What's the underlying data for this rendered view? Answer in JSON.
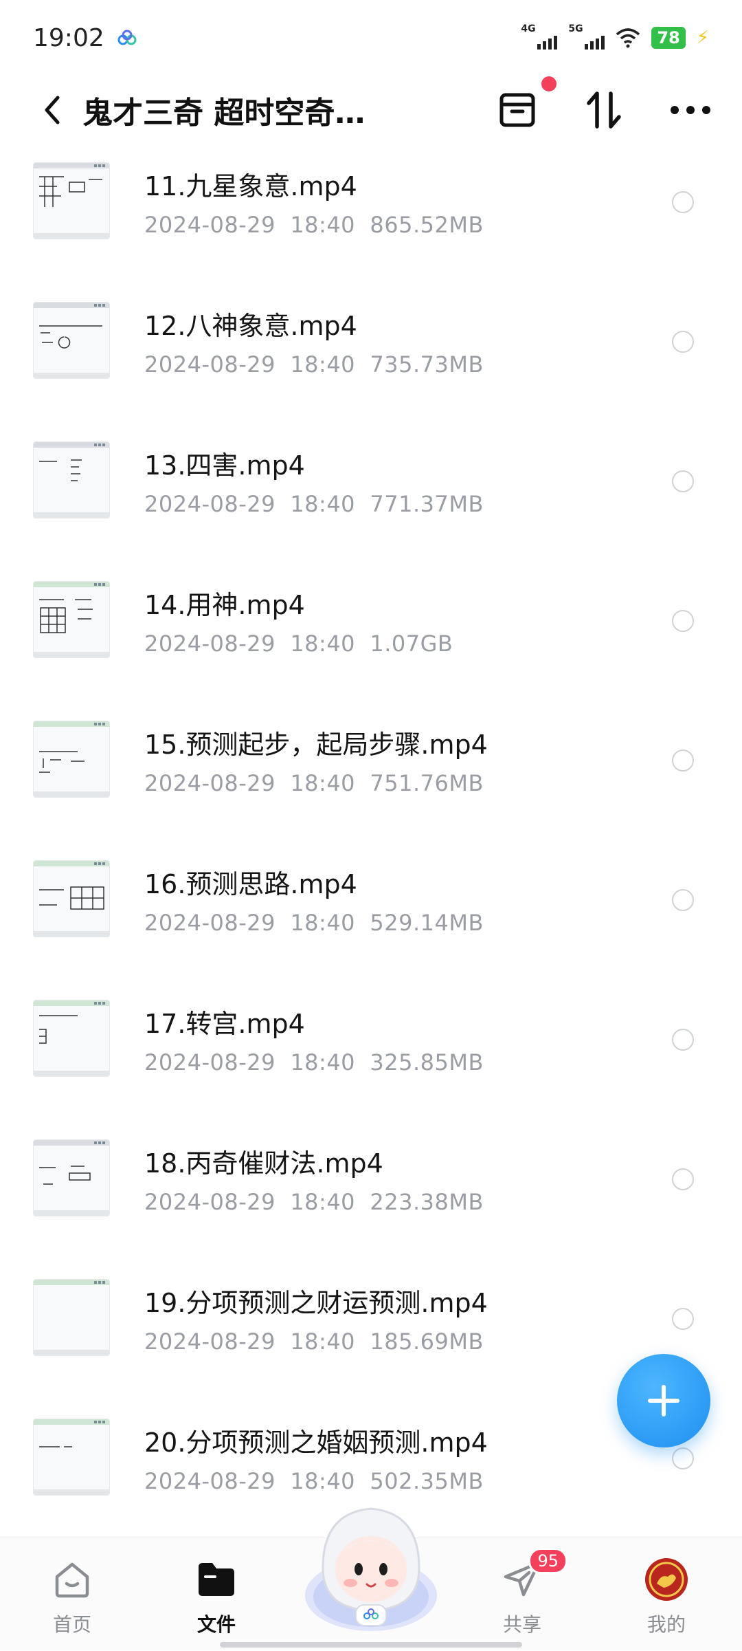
{
  "status_bar": {
    "time": "19:02",
    "network_1": "4G",
    "network_2": "5G",
    "battery": "78"
  },
  "header": {
    "title": "鬼才三奇 超时空奇…"
  },
  "files": [
    {
      "name": "11.九星象意.mp4",
      "date": "2024-08-29",
      "time": "18:40",
      "size": "865.52MB"
    },
    {
      "name": "12.八神象意.mp4",
      "date": "2024-08-29",
      "time": "18:40",
      "size": "735.73MB"
    },
    {
      "name": "13.四害.mp4",
      "date": "2024-08-29",
      "time": "18:40",
      "size": "771.37MB"
    },
    {
      "name": "14.用神.mp4",
      "date": "2024-08-29",
      "time": "18:40",
      "size": "1.07GB"
    },
    {
      "name": "15.预测起步，起局步骤.mp4",
      "date": "2024-08-29",
      "time": "18:40",
      "size": "751.76MB"
    },
    {
      "name": "16.预测思路.mp4",
      "date": "2024-08-29",
      "time": "18:40",
      "size": "529.14MB"
    },
    {
      "name": "17.转宫.mp4",
      "date": "2024-08-29",
      "time": "18:40",
      "size": "325.85MB"
    },
    {
      "name": "18.丙奇催财法.mp4",
      "date": "2024-08-29",
      "time": "18:40",
      "size": "223.38MB"
    },
    {
      "name": "19.分项预测之财运预测.mp4",
      "date": "2024-08-29",
      "time": "18:40",
      "size": "185.69MB"
    },
    {
      "name": "20.分项预测之婚姻预测.mp4",
      "date": "2024-08-29",
      "time": "18:40",
      "size": "502.35MB"
    }
  ],
  "tabs": [
    {
      "label": "首页",
      "icon": "home-icon"
    },
    {
      "label": "文件",
      "icon": "folder-icon"
    },
    {
      "label": "共享",
      "icon": "share-icon",
      "badge": "95"
    },
    {
      "label": "我的",
      "icon": "avatar"
    }
  ],
  "colors": {
    "accent": "#1e8ff0",
    "badge": "#f5405b",
    "meta_text": "#9a9ea4",
    "battery": "#33c04a"
  }
}
